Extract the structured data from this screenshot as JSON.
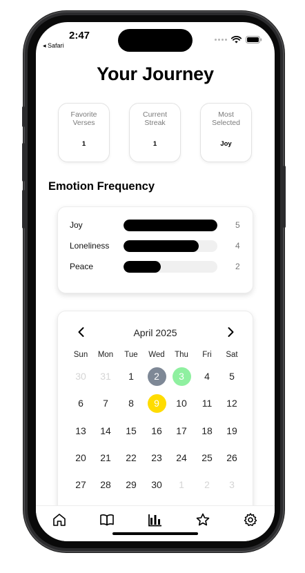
{
  "status_bar": {
    "time": "2:47",
    "back_label": "◂ Safari"
  },
  "page_title": "Your Journey",
  "stats": [
    {
      "label": "Favorite Verses",
      "value": "1"
    },
    {
      "label": "Current Streak",
      "value": "1"
    },
    {
      "label": "Most Selected",
      "value": "Joy"
    }
  ],
  "emotion_section_title": "Emotion Frequency",
  "emotions": [
    {
      "name": "Joy",
      "count": "5",
      "fraction": 1.0
    },
    {
      "name": "Loneliness",
      "count": "4",
      "fraction": 0.8
    },
    {
      "name": "Peace",
      "count": "2",
      "fraction": 0.4
    }
  ],
  "calendar": {
    "month_label": "April 2025",
    "weekdays": [
      "Sun",
      "Mon",
      "Tue",
      "Wed",
      "Thu",
      "Fri",
      "Sat"
    ],
    "weeks": [
      [
        "30",
        "31",
        "1",
        "2",
        "3",
        "4",
        "5"
      ],
      [
        "6",
        "7",
        "8",
        "9",
        "10",
        "11",
        "12"
      ],
      [
        "13",
        "14",
        "15",
        "16",
        "17",
        "18",
        "19"
      ],
      [
        "20",
        "21",
        "22",
        "23",
        "24",
        "25",
        "26"
      ],
      [
        "27",
        "28",
        "29",
        "30",
        "1",
        "2",
        "3"
      ]
    ],
    "highlights": [
      {
        "day": "2",
        "week": 0,
        "col": 3,
        "color": "#7e8896",
        "text_color": "#ffffff"
      },
      {
        "day": "3",
        "week": 0,
        "col": 4,
        "color": "#8ff0a0",
        "text_color": "#ffffff"
      },
      {
        "day": "9",
        "week": 1,
        "col": 3,
        "color": "#ffdc00",
        "text_color": "#ffffff"
      }
    ]
  },
  "tabs": [
    {
      "name": "home",
      "icon": "home-icon",
      "active": false
    },
    {
      "name": "verses",
      "icon": "book-icon",
      "active": false
    },
    {
      "name": "journey",
      "icon": "bar-chart-icon",
      "active": true
    },
    {
      "name": "favorites",
      "icon": "star-icon",
      "active": false
    },
    {
      "name": "settings",
      "icon": "gear-icon",
      "active": false
    }
  ]
}
